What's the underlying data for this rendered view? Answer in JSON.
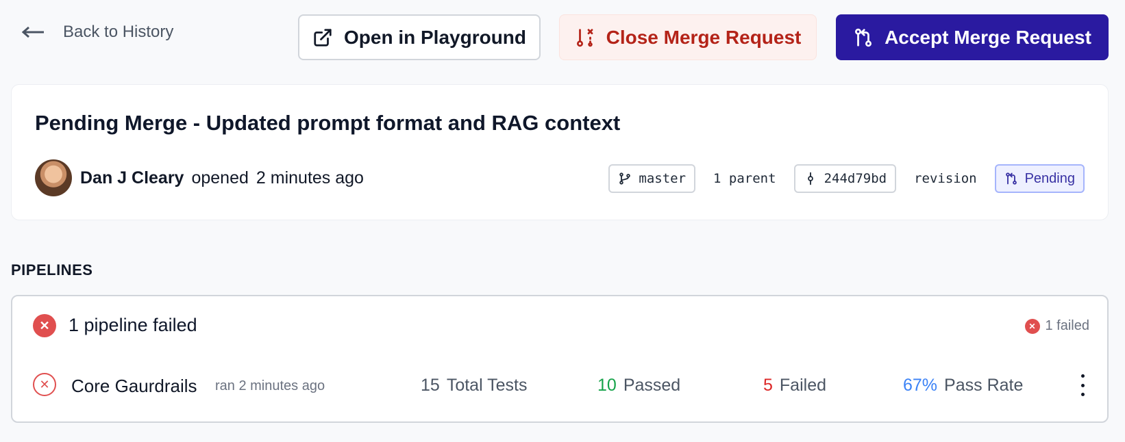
{
  "topbar": {
    "back_label": "Back to History",
    "open_playground_label": "Open in Playground",
    "close_mr_label": "Close Merge Request",
    "accept_mr_label": "Accept Merge Request"
  },
  "merge_request": {
    "title": "Pending Merge - Updated prompt format and RAG context",
    "author": "Dan J Cleary",
    "action": "opened",
    "time": "2 minutes ago",
    "branch": "master",
    "parent_text": "1 parent",
    "commit": "244d79bd",
    "revision_text": "revision",
    "status": "Pending"
  },
  "pipelines": {
    "section_label": "PIPELINES",
    "summary": "1 pipeline failed",
    "failed_count": "1 failed",
    "rows": [
      {
        "name": "Core Gaurdrails",
        "ran": "ran 2 minutes ago",
        "total_value": "15",
        "total_label": "Total Tests",
        "passed_value": "10",
        "passed_label": "Passed",
        "failed_value": "5",
        "failed_label": "Failed",
        "rate_value": "67%",
        "rate_label": "Pass Rate"
      }
    ]
  },
  "colors": {
    "accept": "#2a1aa0",
    "close_text": "#b42318",
    "fail": "#e04f4f",
    "passed": "#16a34a",
    "rate": "#3b82f6"
  },
  "icons": [
    "arrow-left-icon",
    "external-link-icon",
    "git-pull-request-closed-icon",
    "git-pull-request-icon",
    "git-branch-icon",
    "git-commit-icon",
    "x-circle-icon",
    "kebab-icon"
  ]
}
